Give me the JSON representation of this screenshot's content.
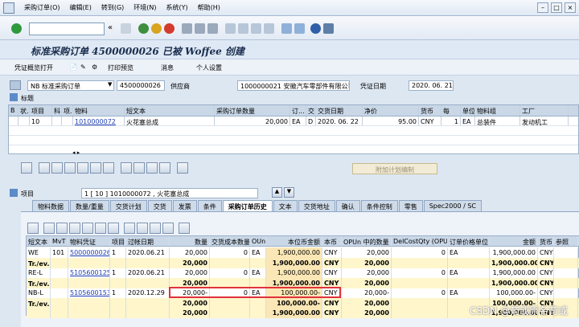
{
  "menu": [
    "采购订单(O)",
    "编辑(E)",
    "转到(G)",
    "环境(N)",
    "系统(Y)",
    "帮助(H)"
  ],
  "title": "标准采购订单 4500000026 已被 Woffee 创建",
  "app_toolbar": {
    "toggle_docs": "凭证概览打开",
    "print_preview": "打印预览",
    "messages": "消息",
    "personal_settings": "个人设置"
  },
  "header": {
    "doc_type": "NB 标准采购订单",
    "po_number": "4500000026",
    "vendor_label": "供应商",
    "vendor_value": "1000000021 安徽汽车零部件有限公司",
    "doc_date_label": "凭证日期",
    "doc_date_value": "2020. 06. 21",
    "header_label": "标题"
  },
  "item_overview": {
    "columns": [
      "B",
      "状.",
      "项目",
      "科",
      "项.",
      "物料",
      "短文本",
      "采购订单数量",
      "订...",
      "交",
      "交货日期",
      "净价",
      "货币",
      "每",
      "单位",
      "物料组",
      "工厂"
    ],
    "row": [
      "",
      "",
      "10",
      "",
      "",
      "1010000072",
      "火花塞总成",
      "20,000",
      "EA",
      "D",
      "2020. 06. 22",
      "95.00",
      "CNY",
      "1",
      "EA",
      "总装件",
      "发动机工"
    ]
  },
  "planning_button": "附加计划编制",
  "item_detail": {
    "label": "项目",
    "selected": "1 [ 10 ] 1010000072 , 火花塞总成"
  },
  "tabs": [
    "物料数据",
    "数量/重量",
    "交货计划",
    "交货",
    "发票",
    "条件",
    "采购订单历史",
    "文本",
    "交货地址",
    "确认",
    "条件控制",
    "零售",
    "Spec2000 / SC"
  ],
  "active_tab": "采购订单历史",
  "history": {
    "columns": [
      "短文本",
      "MvT",
      "物料凭证",
      "项目",
      "过帐日期",
      "数量",
      "交货成本数量",
      "OUn",
      "本位币金额",
      "本币",
      "OPUn 中的数量",
      "DelCostQty (OPUn)",
      "订单价格单位",
      "金额",
      "货币",
      "参照"
    ],
    "rows": [
      {
        "type": "row",
        "cells": [
          "WE",
          "101",
          "5000000026",
          "1",
          "2020.06.21",
          "20,000",
          "0",
          "EA",
          "1,900,000.00",
          "CNY",
          "20,000",
          "0",
          "EA",
          "1,900,000.00",
          "CNY",
          ""
        ]
      },
      {
        "type": "sub",
        "cells": [
          "Tr./ev. 收货",
          "",
          "",
          "",
          "",
          "20,000",
          "",
          "",
          "1,900,000.00",
          "CNY",
          "20,000",
          "",
          "",
          "1,900,000.00",
          "CNY",
          ""
        ]
      },
      {
        "type": "row",
        "cells": [
          "RE-L",
          "",
          "5105600125",
          "1",
          "2020.06.21",
          "20,000",
          "0",
          "EA",
          "1,900,000.00",
          "CNY",
          "20,000",
          "0",
          "EA",
          "1,900,000.00",
          "CNY",
          ""
        ]
      },
      {
        "type": "sub",
        "cells": [
          "Tr./ev. 发票收据",
          "",
          "",
          "",
          "",
          "20,000",
          "",
          "",
          "1,900,000.00",
          "CNY",
          "20,000",
          "",
          "",
          "1,900,000.00",
          "CNY",
          ""
        ]
      },
      {
        "type": "row",
        "cells": [
          "NB-L",
          "",
          "5105600153",
          "1",
          "2020.12.29",
          "20,000-",
          "0",
          "EA",
          "100,000.00-",
          "CNY",
          "20,000-",
          "0",
          "EA",
          "100,000.00-",
          "CNY",
          ""
        ]
      },
      {
        "type": "sub",
        "cells": [
          "Tr./ev. 有借方日志描述的IV",
          "",
          "",
          "",
          "",
          "20,000",
          "",
          "",
          "100,000.00-",
          "CNY",
          "20,000",
          "",
          "",
          "100,000.00-",
          "CNY",
          ""
        ]
      },
      {
        "type": "sub",
        "cells": [
          "",
          "",
          "",
          "",
          "",
          "20,000",
          "",
          "",
          "1,900,000.00",
          "CNY",
          "20,000",
          "",
          "",
          "1,900,000.00",
          "CNY",
          ""
        ]
      }
    ]
  },
  "watermark": "CSDN @苟或原名苟或"
}
